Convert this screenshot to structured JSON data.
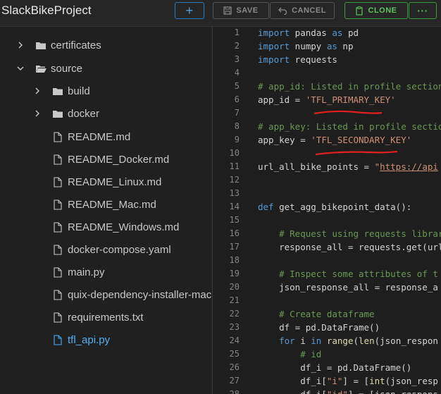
{
  "header": {
    "title": "SlackBikeProject",
    "add_label": "+",
    "save_label": "SAVE",
    "cancel_label": "CANCEL",
    "clone_label": "CLONE",
    "more_label": "···"
  },
  "tree": {
    "items": [
      {
        "label": "certificates",
        "type": "folder",
        "expanded": false
      },
      {
        "label": "source",
        "type": "folder",
        "expanded": true
      },
      {
        "label": "build",
        "type": "folder",
        "expanded": false
      },
      {
        "label": "docker",
        "type": "folder",
        "expanded": false
      },
      {
        "label": "README.md",
        "type": "file"
      },
      {
        "label": "README_Docker.md",
        "type": "file"
      },
      {
        "label": "README_Linux.md",
        "type": "file"
      },
      {
        "label": "README_Mac.md",
        "type": "file"
      },
      {
        "label": "README_Windows.md",
        "type": "file"
      },
      {
        "label": "docker-compose.yaml",
        "type": "file"
      },
      {
        "label": "main.py",
        "type": "file"
      },
      {
        "label": "quix-dependency-installer-mac",
        "type": "file"
      },
      {
        "label": "requirements.txt",
        "type": "file"
      },
      {
        "label": "tfl_api.py",
        "type": "file",
        "active": true
      }
    ]
  },
  "editor": {
    "line_numbers": [
      "1",
      "2",
      "3",
      "4",
      "5",
      "6",
      "7",
      "8",
      "9",
      "10",
      "11",
      "12",
      "13",
      "14",
      "15",
      "16",
      "17",
      "18",
      "19",
      "20",
      "21",
      "22",
      "23",
      "24",
      "25",
      "26",
      "27",
      "28"
    ],
    "lines": [
      "import pandas as pd",
      "import numpy as np",
      "import requests",
      "",
      "# app_id: Listed in profile section",
      "app_id = 'TFL_PRIMARY_KEY'",
      "",
      "# app_key: Listed in profile section",
      "app_key = 'TFL_SECONDARY_KEY'",
      "",
      "url_all_bike_points = \"https://api",
      "",
      "",
      "def get_agg_bikepoint_data():",
      "",
      "    # Request using requests library",
      "    response_all = requests.get(url",
      "",
      "    # Inspect some attributes of t",
      "    json_response_all = response_a",
      "",
      "    # Create dataframe",
      "    df = pd.DataFrame()",
      "    for i in range(len(json_respon",
      "        # id",
      "        df_i = pd.DataFrame()",
      "        df_i[\"i\"] = [int(json_resp",
      "        df_i[\"id\"] = [json_respons"
    ]
  },
  "colors": {
    "accent_blue": "#4da3e6",
    "accent_green": "#5cc45c",
    "annotation_red": "#e02020"
  }
}
